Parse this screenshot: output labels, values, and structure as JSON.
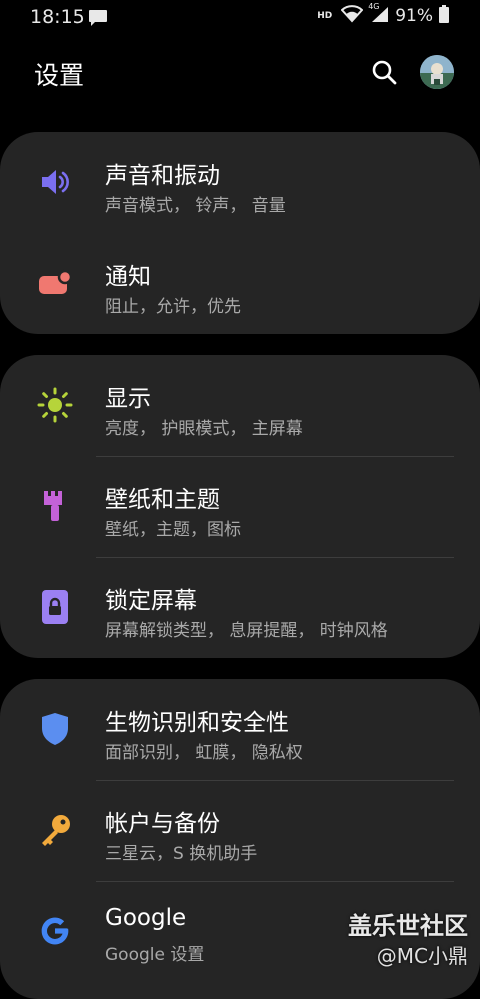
{
  "status_bar": {
    "time": "18:15",
    "hd": "HD",
    "network": "4G",
    "battery_percent": "91%"
  },
  "header": {
    "title": "设置"
  },
  "groups": [
    {
      "items": [
        {
          "title": "声音和振动",
          "subtitle": "声音模式，  铃声，  音量",
          "icon": "speaker-icon",
          "color": "#7b6ff0"
        },
        {
          "title": "通知",
          "subtitle": "阻止，允许，优先",
          "icon": "notification-icon",
          "color": "#f07870"
        }
      ]
    },
    {
      "items": [
        {
          "title": "显示",
          "subtitle": "亮度，  护眼模式，  主屏幕",
          "icon": "sun-icon",
          "color": "#b6d43a"
        },
        {
          "title": "壁纸和主题",
          "subtitle": "壁纸，主题，图标",
          "icon": "brush-icon",
          "color": "#c462d8"
        },
        {
          "title": "锁定屏幕",
          "subtitle": "屏幕解锁类型，  息屏提醒，  时钟风格",
          "icon": "lock-icon",
          "color": "#9b80f2"
        }
      ]
    },
    {
      "items": [
        {
          "title": "生物识别和安全性",
          "subtitle": "面部识别，  虹膜，  隐私权",
          "icon": "shield-icon",
          "color": "#5b8ef0"
        },
        {
          "title": "帐户与备份",
          "subtitle": "三星云，S 换机助手",
          "icon": "key-icon",
          "color": "#f2aa3c"
        },
        {
          "title": "Google",
          "subtitle": "Google 设置",
          "icon": "google-icon",
          "color": "#4285f4"
        }
      ]
    }
  ],
  "watermark": {
    "line1": "盖乐世社区",
    "line2": "@MC小鼎"
  }
}
